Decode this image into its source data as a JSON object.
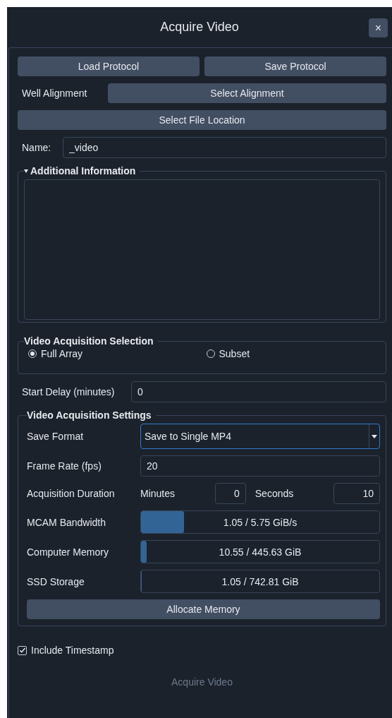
{
  "window": {
    "title": "Acquire Video",
    "close": "×"
  },
  "protocol_buttons": [
    {
      "label": "Load Protocol"
    },
    {
      "label": "Save Protocol"
    }
  ],
  "well_alignment": {
    "label": "Well Alignment",
    "button": "Select Alignment"
  },
  "file_location_button": "Select File Location",
  "name_field": {
    "label": "Name:",
    "value": "_video"
  },
  "additional_information": {
    "title": "Additional Information",
    "expanded": true
  },
  "acquisition_selection": {
    "title": "Video Acquisition Selection",
    "options": [
      {
        "label": "Full Array",
        "selected": true
      },
      {
        "label": "Subset",
        "selected": false
      }
    ]
  },
  "start_delay": {
    "label": "Start Delay (minutes)",
    "value": "0"
  },
  "settings": {
    "title": "Video Acquisition Settings",
    "save_format": {
      "label": "Save Format",
      "value": "Save to Single MP4"
    },
    "frame_rate": {
      "label": "Frame Rate (fps)",
      "value": "20"
    },
    "duration": {
      "label": "Acquisition Duration",
      "minutes_label": "Minutes",
      "minutes": "0",
      "seconds_label": "Seconds",
      "seconds": "10"
    },
    "meters": [
      {
        "label": "MCAM Bandwidth",
        "level": 0.18,
        "reading": "1.05 / 5.75 GiB/s"
      },
      {
        "label": "Computer Memory",
        "level": 0.024,
        "reading": "10.55 / 445.63 GiB"
      },
      {
        "label": "SSD Storage",
        "level": 0.0014,
        "reading": "1.05 / 742.81 GiB"
      }
    ],
    "allocate_button": "Allocate Memory"
  },
  "include_timestamp": {
    "label": "Include Timestamp",
    "checked": true
  },
  "acquire_button": {
    "label": "Acquire Video",
    "disabled": true
  }
}
